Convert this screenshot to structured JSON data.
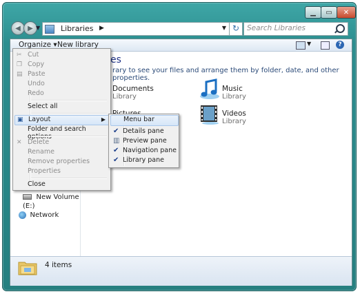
{
  "window": {
    "minimize_icon": "minimize-icon",
    "maximize_icon": "maximize-icon",
    "close_icon": "close-icon",
    "accent_color": "#2c8e8f"
  },
  "addressbar": {
    "path_root": "Libraries",
    "search_placeholder": "Search Libraries"
  },
  "toolbar": {
    "organize_label": "Organize",
    "new_library_label": "New library"
  },
  "content": {
    "title_fragment": "es",
    "description_fragment": "rary to see your files and arrange them by folder, date, and other properties.",
    "libraries": [
      {
        "name": "Documents",
        "type": "Library",
        "icon": "documents-icon"
      },
      {
        "name": "Music",
        "type": "Library",
        "icon": "music-icon"
      },
      {
        "name": "Pictures",
        "type": "",
        "icon": "pictures-icon"
      },
      {
        "name": "Videos",
        "type": "Library",
        "icon": "videos-icon"
      }
    ]
  },
  "navpane": {
    "drive": "New Volume (E:)",
    "network": "Network"
  },
  "details": {
    "items_count": "4 items"
  },
  "organize_menu": {
    "items": [
      {
        "label": "Cut",
        "enabled": false
      },
      {
        "label": "Copy",
        "enabled": false
      },
      {
        "label": "Paste",
        "enabled": false
      },
      {
        "label": "Undo",
        "enabled": false
      },
      {
        "label": "Redo",
        "enabled": false
      },
      {
        "label": "Select all",
        "enabled": true
      },
      {
        "label": "Layout",
        "enabled": true,
        "submenu": true
      },
      {
        "label": "Folder and search options",
        "enabled": true
      },
      {
        "label": "Delete",
        "enabled": false
      },
      {
        "label": "Rename",
        "enabled": false
      },
      {
        "label": "Remove properties",
        "enabled": false
      },
      {
        "label": "Properties",
        "enabled": false
      },
      {
        "label": "Close",
        "enabled": true
      }
    ]
  },
  "layout_menu": {
    "items": [
      {
        "label": "Menu bar",
        "checked": false
      },
      {
        "label": "Details pane",
        "checked": true
      },
      {
        "label": "Preview pane",
        "checked": false
      },
      {
        "label": "Navigation pane",
        "checked": true
      },
      {
        "label": "Library pane",
        "checked": true
      }
    ]
  }
}
